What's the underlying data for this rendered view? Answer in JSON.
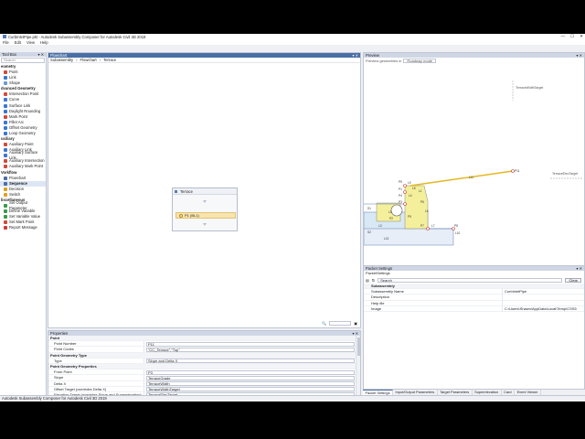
{
  "window": {
    "title": "CurbInletPipe.pkt - Autodesk Subassembly Composer for Autodesk Civil 3D 2019",
    "min": "—",
    "max": "☐",
    "close": "✕"
  },
  "menu": [
    "File",
    "Edit",
    "View",
    "Help"
  ],
  "toolbox": {
    "title": "Tool Box",
    "search_placeholder": "Search",
    "categories": [
      {
        "label": "eometry",
        "items": [
          {
            "label": "Point",
            "icon": "point-icon",
            "color": "#d24a3a"
          },
          {
            "label": "Link",
            "icon": "link-icon",
            "color": "#3a78d2"
          },
          {
            "label": "Shape",
            "icon": "shape-icon",
            "color": "#6a9ad8"
          }
        ]
      },
      {
        "label": "dvanced Geometry",
        "items": [
          {
            "label": "Intersection Point",
            "icon": "intersection-point-icon",
            "color": "#d24a3a"
          },
          {
            "label": "Curve",
            "icon": "curve-icon",
            "color": "#3a78d2"
          },
          {
            "label": "Surface Link",
            "icon": "surface-link-icon",
            "color": "#3a78d2"
          },
          {
            "label": "Daylight Rounding",
            "icon": "daylight-rounding-icon",
            "color": "#3a78d2"
          },
          {
            "label": "Mark Point",
            "icon": "mark-point-icon",
            "color": "#d24a3a"
          },
          {
            "label": "Fillet Arc",
            "icon": "fillet-arc-icon",
            "color": "#3a78d2"
          },
          {
            "label": "Offset Geometry",
            "icon": "offset-geometry-icon",
            "color": "#3a78d2"
          },
          {
            "label": "Loop Geometry",
            "icon": "loop-geometry-icon",
            "color": "#3a78d2"
          }
        ]
      },
      {
        "label": "uxiliary",
        "items": [
          {
            "label": "Auxiliary Point",
            "icon": "auxiliary-point-icon",
            "color": "#d24a3a"
          },
          {
            "label": "Auxiliary Link",
            "icon": "auxiliary-link-icon",
            "color": "#3a78d2"
          },
          {
            "label": "Auxiliary Surface Link",
            "icon": "auxiliary-surface-link-icon",
            "color": "#3a78d2"
          },
          {
            "label": "Auxiliary Intersection",
            "icon": "auxiliary-intersection-icon",
            "color": "#d24a3a"
          },
          {
            "label": "Auxiliary Mark Point",
            "icon": "auxiliary-mark-point-icon",
            "color": "#d24a3a"
          }
        ]
      },
      {
        "label": "Vorkflow",
        "items": [
          {
            "label": "Flowchart",
            "icon": "flowchart-icon",
            "color": "#4a6fa5"
          },
          {
            "label": "Sequence",
            "icon": "sequence-icon",
            "color": "#4a6fa5",
            "selected": true
          },
          {
            "label": "Decision",
            "icon": "decision-icon",
            "color": "#e0a020"
          },
          {
            "label": "Switch",
            "icon": "switch-icon",
            "color": "#e0a020"
          }
        ]
      },
      {
        "label": "liscellaneous",
        "items": [
          {
            "label": "Set Output Parameter",
            "icon": "set-output-parameter-icon",
            "color": "#3a9a4a"
          },
          {
            "label": "Define Variable",
            "icon": "define-variable-icon",
            "color": "#3a9a4a"
          },
          {
            "label": "Set Variable Value",
            "icon": "set-variable-value-icon",
            "color": "#3a9a4a"
          },
          {
            "label": "Set Mark Point",
            "icon": "set-mark-point-icon",
            "color": "#d24a3a"
          },
          {
            "label": "Report Message",
            "icon": "report-message-icon",
            "color": "#d23a3a"
          }
        ]
      }
    ]
  },
  "flowchart": {
    "title": "Flowchart",
    "breadcrumbs": [
      "Subassembly",
      "Flowchart",
      "Terrace"
    ],
    "node_title": "Terrace",
    "point_label": "P1 (BL1)"
  },
  "properties": {
    "title": "Properties",
    "rows": [
      {
        "type": "cat",
        "k": "Point"
      },
      {
        "k": "Point Number",
        "v": "P11"
      },
      {
        "k": "Point Codes",
        "v": "\"CC_Terrace\",\"Top\""
      },
      {
        "type": "cat",
        "k": "Point Geometry Type"
      },
      {
        "k": "Type",
        "v": "Slope and Delta X"
      },
      {
        "type": "cat",
        "k": "Point Geometry Properties"
      },
      {
        "k": "From Point",
        "v": "P3"
      },
      {
        "k": "Slope",
        "v": "TerraceGrade"
      },
      {
        "k": "Delta X",
        "v": "TerraceWidth"
      },
      {
        "k": "Offset Target (overrides Delta X)",
        "v": "TerraceWidthTarget"
      },
      {
        "k": "Elevation Target (overrides Slope and Superelevation)",
        "v": "TerraceElevTarget"
      },
      {
        "k": "Superelevation (overrides Slope)",
        "v": "None"
      }
    ]
  },
  "preview": {
    "title": "Preview",
    "option_label": "Preview geometries in",
    "option_value": "Roadway mode",
    "codes_label": "Codes",
    "comments_label": "Comments",
    "fit_label": "Fit to Screen",
    "target_label_1": "TerraceWidthTarget",
    "target_label_2": "TerraceElevTarget",
    "labels": [
      "P11",
      "L11",
      "L9",
      "P9",
      "L8",
      "P1",
      "L1",
      "P4",
      "L4",
      "P3",
      "S1",
      "L5",
      "P2",
      "P6",
      "L6",
      "P5",
      "L3",
      "P7",
      "L7",
      "P8",
      "L10",
      "S2",
      "L13"
    ]
  },
  "packet": {
    "title": "Packet Settings",
    "subtitle": "PacketSettings",
    "search_label": "Search",
    "clear_label": "Clear",
    "rows": [
      {
        "type": "cat",
        "k": "Subassembly"
      },
      {
        "k": "Subassembly Name",
        "v": "CurbInletPipe"
      },
      {
        "k": "Description",
        "v": ""
      },
      {
        "k": "Help file",
        "v": ""
      },
      {
        "k": "Image",
        "v": "C:\\Users\\Shawn\\AppData\\Local\\Temp\\CSS5"
      }
    ]
  },
  "tabs": [
    "Packet Settings",
    "Input/Output Parameters",
    "Target Parameters",
    "Superelevation",
    "Card",
    "Event Viewer"
  ],
  "status": "Autodesk Subassembly Composer for Autodesk Civil 3D 2019"
}
